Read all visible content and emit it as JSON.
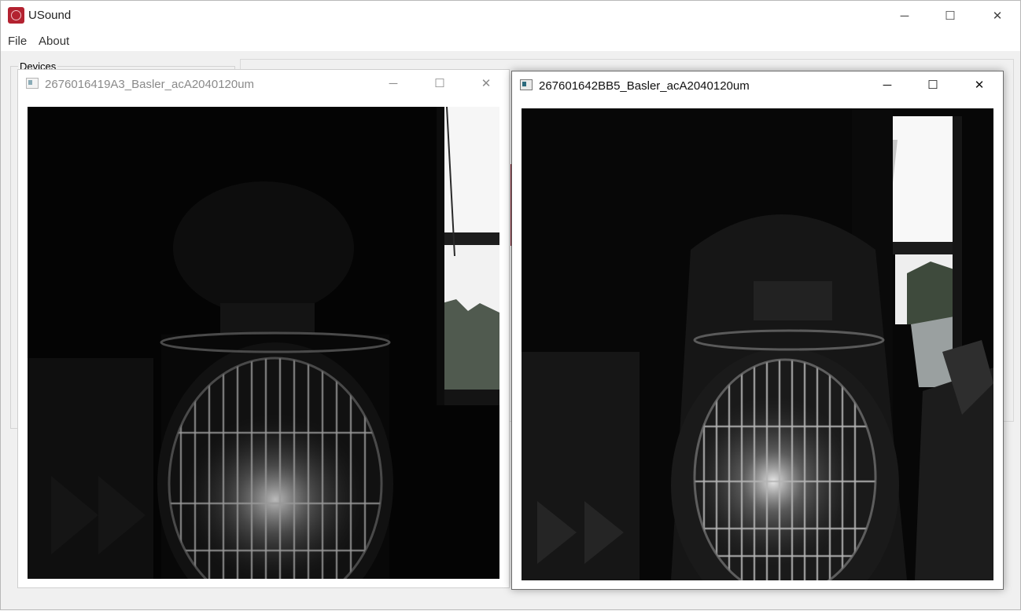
{
  "app": {
    "title": "USound",
    "icon": "usound-logo-icon",
    "controls": {
      "minimize": "─",
      "maximize": "☐",
      "close": "✕"
    }
  },
  "menu": {
    "file": "File",
    "about": "About"
  },
  "devices_group": {
    "label": "Devices"
  },
  "camera_windows": [
    {
      "title": "2676016419A3_Basler_acA2040120um",
      "icon": "camera-window-icon",
      "focused": false
    },
    {
      "title": "267601642BB5_Basler_acA2040120um",
      "icon": "camera-window-icon",
      "focused": true
    }
  ],
  "window_controls": {
    "minimize": "─",
    "maximize": "☐",
    "close": "✕"
  },
  "colors": {
    "accent_red": "#b32230",
    "feed_background": "#050505"
  }
}
